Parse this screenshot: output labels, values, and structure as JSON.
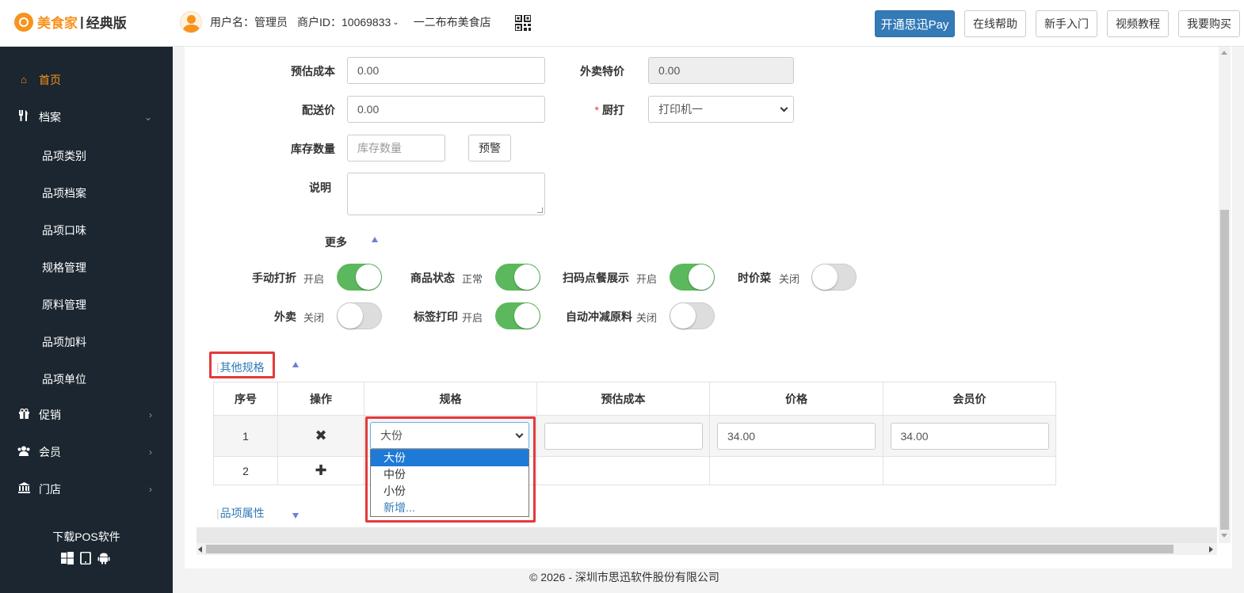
{
  "header": {
    "logo_brand": "美食家",
    "logo_sep": "|",
    "logo_edition": "经典版",
    "username": "用户名：管理员",
    "merchant_id": "商户ID：10069833",
    "store": "一二布布美食店",
    "buttons": [
      "开通思迅Pay",
      "在线帮助",
      "新手入门",
      "视频教程",
      "我要购买"
    ]
  },
  "sidebar": {
    "items": [
      {
        "label": "首页",
        "icon": "home-icon",
        "active": true
      },
      {
        "label": "档案",
        "icon": "utensils-icon",
        "expanded": true
      },
      {
        "label": "促销",
        "icon": "gift-icon"
      },
      {
        "label": "会员",
        "icon": "users-icon"
      },
      {
        "label": "门店",
        "icon": "bank-icon"
      }
    ],
    "sub_items": [
      "品项类别",
      "品项档案",
      "品项口味",
      "规格管理",
      "原料管理",
      "品项加料",
      "品项单位"
    ],
    "download_label": "下载POS软件",
    "platform_icons": [
      "windows-icon",
      "tablet-icon",
      "android-icon"
    ]
  },
  "form": {
    "est_cost_label": "预估成本",
    "est_cost_value": "0.00",
    "takeout_special_label": "外卖特价",
    "takeout_special_value": "0.00",
    "delivery_price_label": "配送价",
    "delivery_price_value": "0.00",
    "kitchen_print_label": "厨打",
    "kitchen_print_value": "打印机一",
    "stock_label": "库存数量",
    "stock_placeholder": "库存数量",
    "alert_button": "预警",
    "note_label": "说明",
    "more_label": "更多"
  },
  "toggles": [
    {
      "label": "手动打折",
      "state": "开启",
      "on": true
    },
    {
      "label": "商品状态",
      "state": "正常",
      "on": true
    },
    {
      "label": "扫码点餐展示",
      "state": "开启",
      "on": true
    },
    {
      "label": "时价菜",
      "state": "关闭",
      "on": false
    },
    {
      "label": "外卖",
      "state": "关闭",
      "on": false
    },
    {
      "label": "标签打印",
      "state": "开启",
      "on": true
    },
    {
      "label": "自动冲减原料",
      "state": "关闭",
      "on": false
    }
  ],
  "spec_section": {
    "title": "其他规格",
    "columns": [
      "序号",
      "操作",
      "规格",
      "预估成本",
      "价格",
      "会员价"
    ],
    "rows": [
      {
        "no": "1",
        "action": "✖",
        "spec": "大份",
        "cost": "",
        "price": "34.00",
        "member_price": "34.00"
      },
      {
        "no": "2",
        "action": "✚"
      }
    ],
    "dropdown_options": [
      "大份",
      "中份",
      "小份",
      "新增..."
    ]
  },
  "attr_section": {
    "title": "品项属性"
  },
  "footer": "© 2026 - 深圳市思迅软件股份有限公司",
  "colors": {
    "brand": "#f7931e",
    "sidebar_bg": "#1b2630",
    "primary": "#337ab7",
    "toggle_on": "#5cb85c",
    "highlight": "#e4393c"
  }
}
